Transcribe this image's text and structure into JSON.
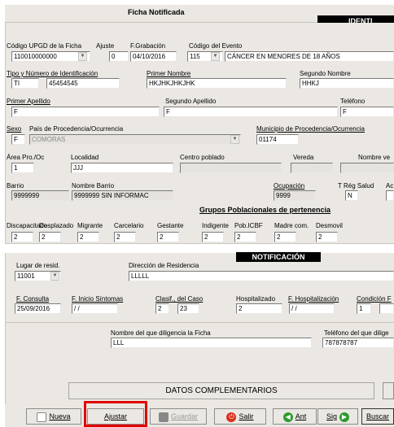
{
  "header": {
    "title": "Ficha Notificada",
    "ident_label": "IDENTI"
  },
  "row1": {
    "codigo_upgd_label": "Código UPGD de la Ficha",
    "codigo_upgd_value": "110010000000",
    "ajuste_label": "Ajuste",
    "ajuste_value": "0",
    "f_grabacion_label": "F.Grabación",
    "f_grabacion_value": "04/10/2016",
    "codigo_evento_label": "Código del Evento",
    "codigo_evento_value": "115",
    "evento_desc": "CÁNCER EN MENORES DE 18 AÑOS"
  },
  "row2": {
    "tipo_label": "Tipo y Número de Identificación",
    "tipo_value": "TI",
    "numero_value": "45454545",
    "primer_nombre_label": "Primer Nombre",
    "primer_nombre_value": "HKJHKJHKJHK",
    "segundo_nombre_label": "Segundo Nombre",
    "segundo_nombre_value": "HHKJ"
  },
  "row3": {
    "primer_apellido_label": "Primer Apellido",
    "primer_apellido_value": "F",
    "segundo_apellido_label": "Segundo Apellido",
    "segundo_apellido_value": "F",
    "telefono_label": "Teléfono",
    "telefono_value": "F"
  },
  "row4": {
    "sexo_label": "Sexo",
    "sexo_value": "F",
    "pais_label": "País de Procedencia/Ocurrencia",
    "pais_value": "COMORAS",
    "municipio_label": "Municipio de Procedencia/Ocurrencia",
    "municipio_value": "01174"
  },
  "row5": {
    "area_label": "Área Pro./Oc",
    "area_value": "1",
    "localidad_label": "Localidad",
    "localidad_value": "JJJ",
    "centro_label": "Centro poblado",
    "centro_value": "",
    "vereda_label": "Vereda",
    "vereda_value": "",
    "nombre_ve_label": "Nombre ve"
  },
  "row6": {
    "barrio_label": "Barrio",
    "barrio_value": "9999999",
    "nombre_barrio_label": "Nombre Barrio",
    "nombre_barrio_value": "9999999 SIN INFORMAC",
    "ocupacion_label": "Ocupación",
    "ocupacion_value": "9999",
    "t_reg_label": "T Rég Salud",
    "t_reg_value": "N",
    "ac_label": "Ac"
  },
  "grupos": {
    "title": "Grupos Poblacionales de pertenencia",
    "items": [
      {
        "label": "Discapacitado",
        "value": "2"
      },
      {
        "label": "Desplazado",
        "value": "2"
      },
      {
        "label": "Migrante",
        "value": "2"
      },
      {
        "label": "Carcelario",
        "value": "2"
      },
      {
        "label": "Gestante",
        "value": "2"
      },
      {
        "label": "Indigente",
        "value": "2"
      },
      {
        "label": "Pob.ICBF",
        "value": "2"
      },
      {
        "label": "Madre com.",
        "value": "2"
      },
      {
        "label": "Desmovil",
        "value": "2"
      }
    ]
  },
  "notificacion": {
    "title": "NOTIFICACIÓN",
    "lugar_label": "Lugar de resid.",
    "lugar_value": "11001",
    "direccion_label": "Dirección de Residencia",
    "direccion_value": "LLLLL",
    "f_consulta_label": "F. Consulta",
    "f_consulta_value": "25/09/2016",
    "f_inicio_label": "F. Inicio Síntomas",
    "f_inicio_value": "/ /",
    "clasif_label": "Clasif., del Caso",
    "clasif_value1": "2",
    "clasif_value2": "23",
    "hospitalizado_label": "Hospitalizado",
    "hospitalizado_value": "2",
    "f_hosp_label": "F. Hospitalización",
    "f_hosp_value": "/ /",
    "condicion_label": "Condición F",
    "condicion_value": "1"
  },
  "diligencia": {
    "nombre_label": "Nombre del que diligencia la Ficha",
    "nombre_value": "LLL",
    "telefono_label": "Teléfono del que dilige",
    "telefono_value": "787878787"
  },
  "buttons": {
    "datos_complementarios": "DATOS COMPLEMENTARIOS",
    "nueva": "Nueva",
    "ajustar": "Ajustar",
    "guardar": "Guardar",
    "salir": "Salir",
    "ant": "Ant",
    "sig": "Sig",
    "buscar": "Buscar"
  }
}
